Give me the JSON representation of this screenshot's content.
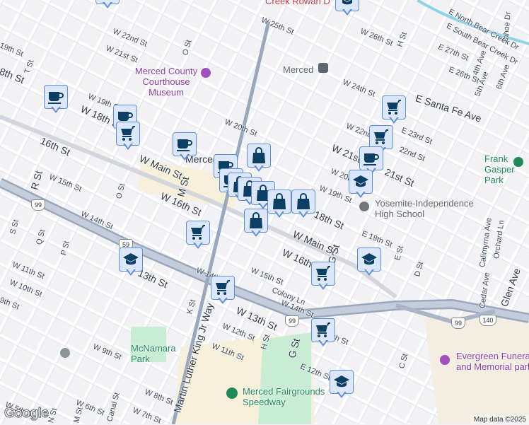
{
  "map": {
    "pois": {
      "courthouse": "Merced County Courthouse Museum",
      "station": "Merced",
      "school": "Yosemite-Independence High School",
      "park1": "Frank Gasper Park",
      "park2": "McNamara Park",
      "speedway": "Merced Fairgrounds Speedway",
      "funeral": "Evergreen Funeral and Memorial park",
      "creek_top": "Creek Rowan D",
      "downtown": "Merced"
    },
    "streets": [
      "W 22nd St",
      "W 21st St",
      "W 25th St",
      "W 26th St",
      "H St",
      "E 27th St",
      "E 26th St",
      "4th Ave",
      "5th Ave",
      "6th Ave",
      "Tahoe Dr",
      "E North Bear Creek Dr",
      "E South Bear Creek Dr",
      "19th St",
      "T St",
      "8th St",
      "O St",
      "W 24th St",
      "E Santa Fe Ave",
      "W 19th St",
      "W 18th St",
      "W 20th St",
      "W 22nd",
      "E 23rd St",
      "22nd St",
      "W 21st St",
      "21st St",
      "16th St",
      "W Main St",
      "M St",
      "W 15th St",
      "R St",
      "O St",
      "W 16th St",
      "W 20th",
      "W 19th St",
      "18th St",
      "W 14th St",
      "W Main St",
      "W 16th St",
      "S St",
      "Q St",
      "P St",
      "W 11th St",
      "W 10th St",
      "9th St",
      "13th St",
      "W 14th St",
      "W 15th St",
      "Colony Ln",
      "W 14th St",
      "W 13th St",
      "G St",
      "E 18th St",
      "E St",
      "D St",
      "Calimyrna Ave",
      "Orchard Ln",
      "Cedar Ave",
      "Glen Ave",
      "W 12th St",
      "W 11th St",
      "H St",
      "G St",
      "E 13th St",
      "K St",
      "W 9th St",
      "Martin Luther King Jr Way",
      "E 12th St",
      "C St",
      "W 8th St",
      "W 7th St",
      "W 6th St",
      "W 5th St",
      "N St",
      "M St",
      "Canal St"
    ],
    "highways": [
      "99",
      "59",
      "99",
      "99",
      "140"
    ],
    "attribution": "Map data ©2025",
    "logo": "Google"
  },
  "colors": {
    "marker_icon": "#0b3f63",
    "marker_bg": "#dde7fb",
    "marker_border": "#5f8fd8",
    "park": "#c8ecd4",
    "water": "#8fd3e6"
  }
}
